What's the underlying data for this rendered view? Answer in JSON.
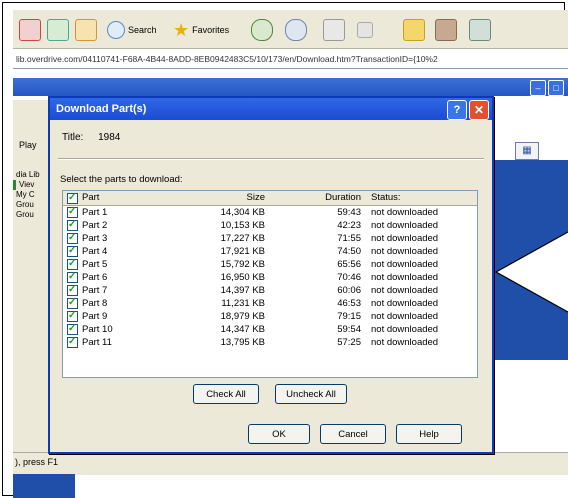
{
  "browser": {
    "toolbar": {
      "search_label": "Search",
      "favorites_label": "Favorites"
    },
    "address_url": "lib.overdrive.com/04110741-F68A-4B44-8ADD-8EB0942483C5/10/173/en/Download.htm?TransactionID={10%2"
  },
  "app": {
    "sidebar": {
      "play_label": "Play",
      "library_items": [
        "dia Lib",
        "Viev",
        "My C",
        "Grou",
        "Grou"
      ]
    },
    "status_text": "), press F1"
  },
  "dialog": {
    "title": "Download Part(s)",
    "title_label": "Title:",
    "title_value": "1984",
    "instructions": "Select the parts to download:",
    "columns": {
      "part": "Part",
      "size": "Size",
      "duration": "Duration",
      "status": "Status:"
    },
    "rows": [
      {
        "part": "Part 1",
        "size": "14,304 KB",
        "duration": "59:43",
        "status": "not downloaded"
      },
      {
        "part": "Part 2",
        "size": "10,153 KB",
        "duration": "42:23",
        "status": "not downloaded"
      },
      {
        "part": "Part 3",
        "size": "17,227 KB",
        "duration": "71:55",
        "status": "not downloaded"
      },
      {
        "part": "Part 4",
        "size": "17,921 KB",
        "duration": "74:50",
        "status": "not downloaded"
      },
      {
        "part": "Part 5",
        "size": "15,792 KB",
        "duration": "65:56",
        "status": "not downloaded"
      },
      {
        "part": "Part 6",
        "size": "16,950 KB",
        "duration": "70:46",
        "status": "not downloaded"
      },
      {
        "part": "Part 7",
        "size": "14,397 KB",
        "duration": "60:06",
        "status": "not downloaded"
      },
      {
        "part": "Part 8",
        "size": "11,231 KB",
        "duration": "46:53",
        "status": "not downloaded"
      },
      {
        "part": "Part 9",
        "size": "18,979 KB",
        "duration": "79:15",
        "status": "not downloaded"
      },
      {
        "part": "Part 10",
        "size": "14,347 KB",
        "duration": "59:54",
        "status": "not downloaded"
      },
      {
        "part": "Part 11",
        "size": "13,795 KB",
        "duration": "57:25",
        "status": "not downloaded"
      }
    ],
    "buttons": {
      "check_all": "Check All",
      "uncheck_all": "Uncheck All",
      "ok": "OK",
      "cancel": "Cancel",
      "help": "Help"
    }
  },
  "colors": {
    "xp_title_blue": "#2457c2",
    "dialog_border": "#0b3bb8",
    "close_red": "#e2512d",
    "check_green": "#21a121",
    "dialog_face": "#ece9d8"
  }
}
